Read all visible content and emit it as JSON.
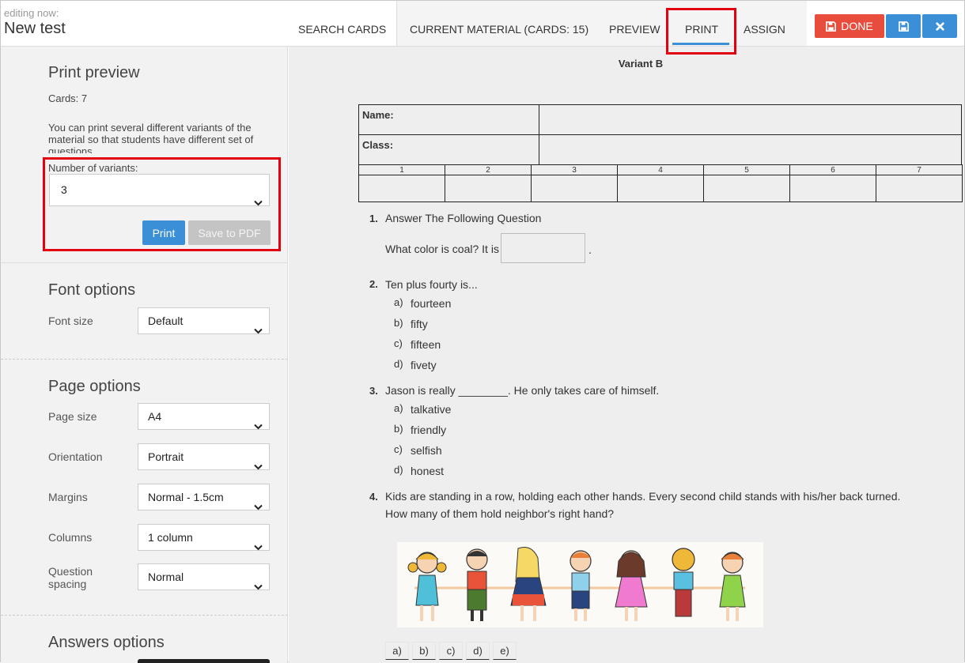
{
  "header": {
    "editing_label": "editing now:",
    "title": "New test",
    "tabs": [
      {
        "label": "SEARCH CARDS"
      },
      {
        "label": "CURRENT MATERIAL (CARDS: 15)"
      },
      {
        "label": "PREVIEW"
      },
      {
        "label": "PRINT",
        "active": true
      },
      {
        "label": "ASSIGN"
      }
    ],
    "done_label": "DONE",
    "colors": {
      "done": "#e74c3c",
      "primary": "#3a8fd6",
      "highlight": "#e3000f"
    }
  },
  "sidebar": {
    "print_preview": {
      "title": "Print preview",
      "cards_count": "Cards: 7",
      "description": "You can print several different variants of the material so that students have different set of questions.",
      "variants_label": "Number of variants:",
      "variants_value": "3",
      "print_label": "Print",
      "pdf_label": "Save to PDF"
    },
    "font_options": {
      "title": "Font options",
      "font_size_label": "Font size",
      "font_size_value": "Default"
    },
    "page_options": {
      "title": "Page options",
      "fields": [
        {
          "label": "Page size",
          "value": "A4"
        },
        {
          "label": "Orientation",
          "value": "Portrait"
        },
        {
          "label": "Margins",
          "value": "Normal - 1.5cm"
        },
        {
          "label": "Columns",
          "value": "1 column"
        },
        {
          "label": "Question spacing",
          "value": "Normal"
        }
      ]
    },
    "answers_options": {
      "title": "Answers options"
    }
  },
  "preview": {
    "variant_title": "Variant B",
    "name_label": "Name:",
    "class_label": "Class:",
    "grid_numbers": [
      "1",
      "2",
      "3",
      "4",
      "5",
      "6",
      "7"
    ],
    "questions": [
      {
        "num": "1.",
        "text": "Answer The Following Question",
        "prompt": "What color is coal? It is",
        "suffix": "."
      },
      {
        "num": "2.",
        "text": "Ten plus fourty is...",
        "options": [
          {
            "letter": "a)",
            "text": "fourteen"
          },
          {
            "letter": "b)",
            "text": "fifty"
          },
          {
            "letter": "c)",
            "text": "fifteen"
          },
          {
            "letter": "d)",
            "text": "fivety"
          }
        ]
      },
      {
        "num": "3.",
        "text": "Jason is really ________. He only takes care of himself.",
        "options": [
          {
            "letter": "a)",
            "text": "talkative"
          },
          {
            "letter": "b)",
            "text": "friendly"
          },
          {
            "letter": "c)",
            "text": "selfish"
          },
          {
            "letter": "d)",
            "text": "honest"
          }
        ]
      },
      {
        "num": "4.",
        "text": "Kids are standing in a row, holding each other hands. Every second child stands with his/her back turned.",
        "text2": "How many of them hold neighbor's right hand?",
        "answers": [
          "a)",
          "b)",
          "c)",
          "d)",
          "e)"
        ]
      }
    ]
  }
}
